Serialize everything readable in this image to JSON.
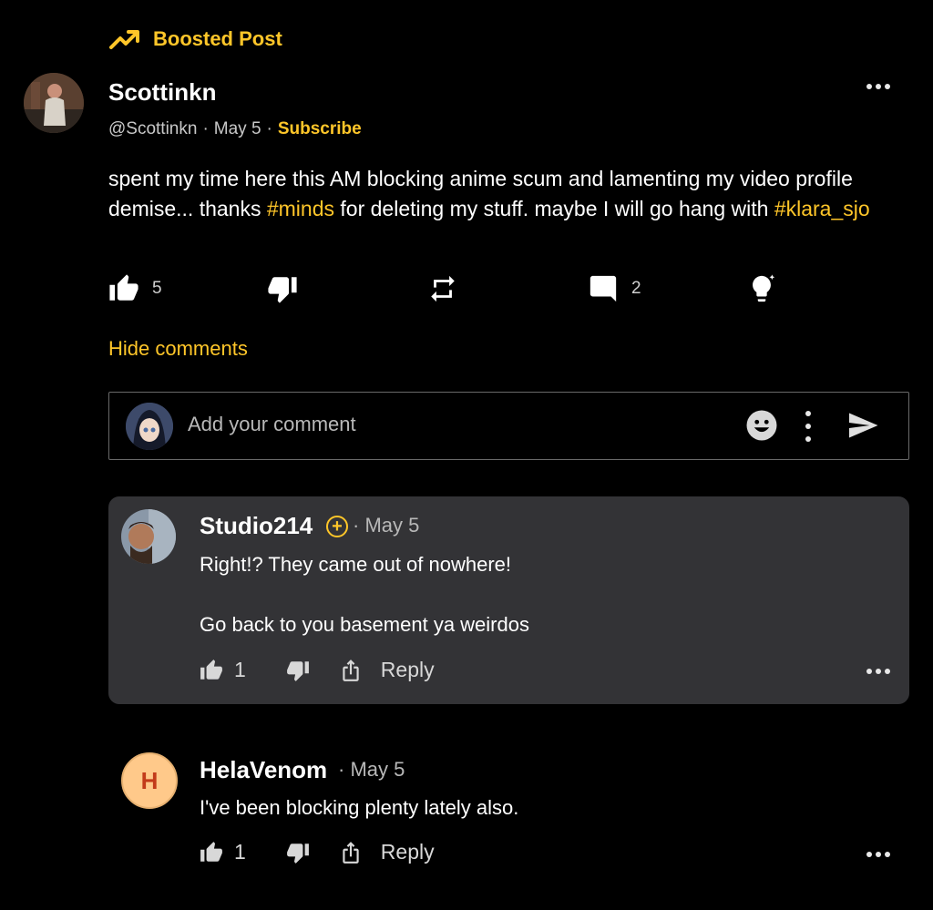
{
  "boosted": {
    "label": "Boosted Post"
  },
  "post": {
    "author_name": "Scottinkn",
    "handle": "@Scottinkn",
    "sep1": "·",
    "date": "May 5",
    "sep2": "·",
    "subscribe_label": "Subscribe",
    "text_part1": "spent my time here this AM blocking anime scum and lamenting my video profile demise... thanks ",
    "tag1": "#minds",
    "text_part2": " for deleting my stuff. maybe I will go hang with ",
    "tag2": "#klara_sjo",
    "upvotes": "5",
    "comments": "2",
    "avatar_icon": "user-avatar"
  },
  "hide_comments_label": "Hide comments",
  "comment_box": {
    "placeholder": "Add your comment"
  },
  "comments": [
    {
      "name": "Studio214",
      "date": "· May 5",
      "line1": "Right!? They came out of nowhere!",
      "line2": "Go back to you basement ya weirdos",
      "upvotes": "1",
      "reply_label": "Reply",
      "badge": "+"
    },
    {
      "initial": "H",
      "name": "HelaVenom",
      "date": "· May 5",
      "line1": "I've been blocking plenty lately also.",
      "upvotes": "1",
      "reply_label": "Reply"
    }
  ],
  "colors": {
    "accent": "#ffc629",
    "background": "#000000",
    "card": "#333336"
  }
}
